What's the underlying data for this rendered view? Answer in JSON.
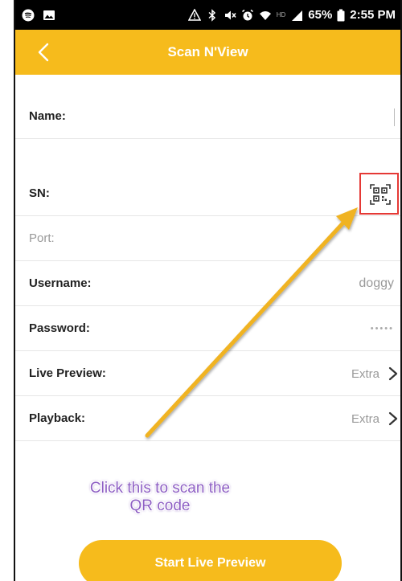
{
  "status_bar": {
    "battery": "65%",
    "time": "2:55 PM",
    "network": "HD",
    "left_icons": [
      "spotify-icon",
      "image-icon"
    ],
    "right_icons": [
      "alert-icon",
      "bluetooth-icon",
      "mute-icon",
      "alarm-icon",
      "wifi-icon",
      "signal-icon",
      "battery-icon"
    ]
  },
  "app_bar": {
    "title": "Scan N'View",
    "background": "#f6bb1c"
  },
  "form": {
    "name": {
      "label": "Name:",
      "value": ""
    },
    "sn": {
      "label": "SN:",
      "value": ""
    },
    "port": {
      "label": "Port:",
      "value": ""
    },
    "username": {
      "label": "Username:",
      "value": "doggy"
    },
    "password": {
      "label": "Password:",
      "value": "•••••"
    },
    "live_preview": {
      "label": "Live Preview:",
      "value": "Extra"
    },
    "playback": {
      "label": "Playback:",
      "value": "Extra"
    }
  },
  "annotation": {
    "line1": "Click this to scan the",
    "line2": "QR code",
    "color": "#8e5fc4",
    "arrow_color": "#f0b323",
    "highlight_color": "#e53935"
  },
  "start_button": {
    "label": "Start Live Preview"
  }
}
